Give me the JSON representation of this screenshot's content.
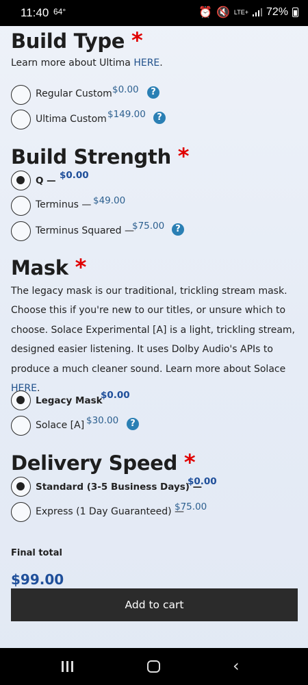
{
  "status": {
    "time": "11:40",
    "temp": "64°",
    "network": "LTE+",
    "battery": "72%"
  },
  "build_type": {
    "heading": "Build Type",
    "required": "*",
    "intro": "Learn more about Ultima ",
    "intro_link": "HERE",
    "intro_end": ".",
    "options": [
      {
        "label": "Regular Custom",
        "price": "$0.00",
        "selected": false
      },
      {
        "label": "Ultima Custom",
        "price": "$149.00",
        "selected": false
      }
    ]
  },
  "build_strength": {
    "heading": "Build Strength",
    "required": "*",
    "options": [
      {
        "label": "Q —",
        "price": "$0.00",
        "selected": true
      },
      {
        "label": "Terminus —",
        "price": "$49.00",
        "selected": false
      },
      {
        "label": "Terminus Squared —",
        "price": "$75.00",
        "selected": false
      }
    ]
  },
  "mask": {
    "heading": "Mask",
    "required": "*",
    "description": "The legacy mask is our traditional, trickling stream mask. Choose this if you're new to our titles, or unsure which to choose. Solace Experimental [A] is a light, trickling stream, designed easier listening. It uses Dolby Audio's APIs to produce a much cleaner sound. Learn more about Solace ",
    "description_link": "HERE",
    "description_end": ".",
    "options": [
      {
        "label": "Legacy Mask",
        "price": "$0.00",
        "selected": true
      },
      {
        "label": "Solace [A]",
        "price": "$30.00",
        "selected": false
      }
    ]
  },
  "delivery_speed": {
    "heading": "Delivery Speed",
    "required": "*",
    "options": [
      {
        "label": "Standard (3-5 Business Days) —",
        "price": "$0.00",
        "selected": true
      },
      {
        "label": "Express (1 Day Guaranteed) —",
        "price": "$75.00",
        "selected": false
      }
    ]
  },
  "total": {
    "label": "Final total",
    "value": "$99.00"
  },
  "actions": {
    "add_to_cart": "Add to cart"
  },
  "icons": {
    "help": "question-circle-icon",
    "alarm": "alarm-icon",
    "mute": "mute-icon",
    "signal": "signal-icon",
    "battery": "battery-icon"
  },
  "colors": {
    "accent_blue": "#1f4f9a",
    "required_red": "#e00000",
    "help_blue": "#2a7fb4",
    "button_dark": "#2b2b2b"
  }
}
